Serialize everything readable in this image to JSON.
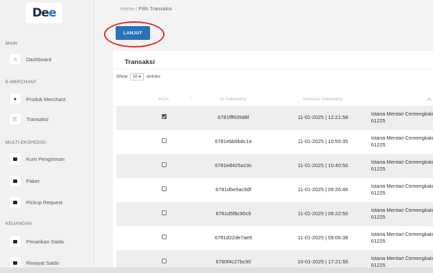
{
  "brand": {
    "logo_dark": "De",
    "logo_blue": "e"
  },
  "sidebar": {
    "sections": [
      {
        "label": "MAIN"
      },
      {
        "label": "E-MERCHANT"
      },
      {
        "label": "MULTI-EKSPEDISI"
      },
      {
        "label": "KEUANGAN"
      }
    ],
    "items": [
      {
        "label": "Dashboard",
        "icon": "home-icon"
      },
      {
        "label": "Produk Merchant",
        "icon": "box-icon"
      },
      {
        "label": "Transaksi",
        "icon": "cart-icon"
      },
      {
        "label": "Kurir Pengiriman",
        "icon": "courier-icon"
      },
      {
        "label": "Paket",
        "icon": "package-icon"
      },
      {
        "label": "Pickup Request",
        "icon": "pickup-icon"
      },
      {
        "label": "Penarikan Saldo",
        "icon": "wallet-icon"
      },
      {
        "label": "Riwayat Saldo",
        "icon": "history-icon"
      }
    ]
  },
  "breadcrumb": {
    "home": "Home",
    "separator": "/",
    "current": "Pilih Transaksi"
  },
  "actions": {
    "lanjut_label": "LANJUT"
  },
  "card": {
    "title": "Transaksi",
    "show_label": "Show",
    "entries_value": "10",
    "entries_label": "entries"
  },
  "table": {
    "columns": {
      "pilih": "PILIH",
      "id": "ID TRANSAKSI",
      "tanggal": "TANGGAL TRANSAKSI",
      "alamat": "AL"
    },
    "rows": [
      {
        "checked": true,
        "id": "6781fff635d8f",
        "date": "11-01-2025 | 12:21:58",
        "addr1": "Istana Mentari Cemengkalang",
        "addr2": "61225"
      },
      {
        "checked": false,
        "id": "6781ebb6b8c1e",
        "date": "11-01-2025 | 10:55:35",
        "addr1": "Istana Mentari Cemengkalang",
        "addr2": "61225"
      },
      {
        "checked": false,
        "id": "6781e8425a19c",
        "date": "11-01-2025 | 10:40:50",
        "addr1": "Istana Mentari Cemengkalang",
        "addr2": "61225"
      },
      {
        "checked": false,
        "id": "6781d6e5ac9df",
        "date": "11-01-2025 | 09:26:46",
        "addr1": "Istana Mentari Cemengkalang",
        "addr2": "61225"
      },
      {
        "checked": false,
        "id": "6781d5f8c90c9",
        "date": "11-01-2025 | 09:22:50",
        "addr1": "Istana Mentari Cemengkalang",
        "addr2": "61225"
      },
      {
        "checked": false,
        "id": "6781d22de7ae9",
        "date": "11-01-2025 | 09:06:38",
        "addr1": "Istana Mentari Cemengkalang",
        "addr2": "61225"
      },
      {
        "checked": false,
        "id": "6780f4c27bc90",
        "date": "10-01-2025 | 17:21:55",
        "addr1": "Istana Mentari Cemengkalang",
        "addr2": "61225"
      }
    ]
  },
  "colors": {
    "primary": "#2b71b8",
    "highlight": "#e0292b",
    "sidebar_bg": "#f1f1ef"
  }
}
